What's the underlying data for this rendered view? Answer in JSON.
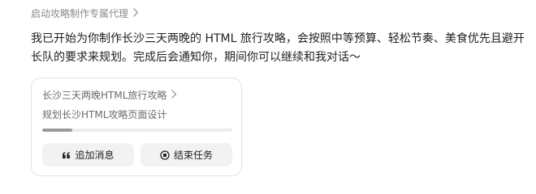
{
  "agent_link": {
    "label": "启动攻略制作专属代理",
    "chevron_icon": "chevron-right-icon"
  },
  "message": {
    "text": "我已开始为你制作长沙三天两晚的 HTML 旅行攻略，会按照中等预算、轻松节奏、美食优先且避开长队的要求来规划。完成后会通知你，期间你可以继续和我对话～"
  },
  "task_card": {
    "title": "长沙三天两晚HTML旅行攻略",
    "subtitle": "规划长沙HTML攻略页面设计",
    "progress": 0.16,
    "buttons": {
      "add_message": {
        "label": "追加消息",
        "icon": "quote-icon"
      },
      "end_task": {
        "label": "结束任务",
        "icon": "stop-circle-icon"
      }
    }
  },
  "colors": {
    "progress_fill": "#9a9a9a",
    "progress_track": "#ececec",
    "button_bg": "#f2f2f2",
    "muted_text": "#8a8a8a"
  }
}
